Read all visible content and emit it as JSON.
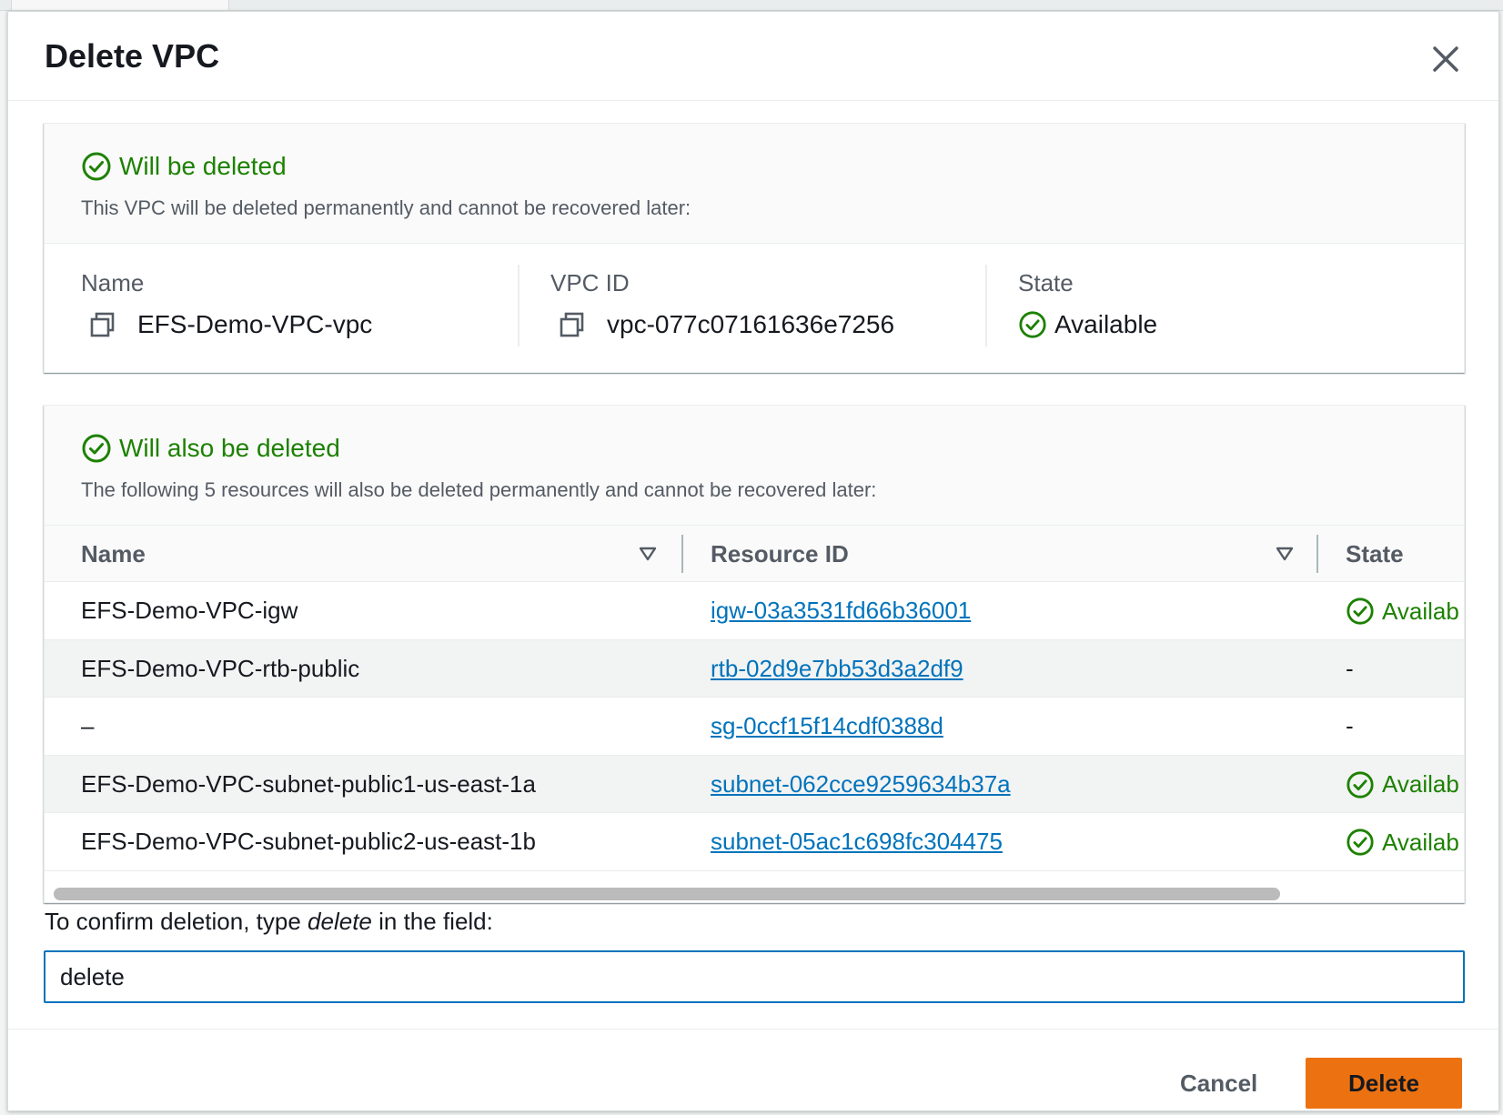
{
  "modal": {
    "title": "Delete VPC"
  },
  "primary": {
    "heading": "Will be deleted",
    "description": "This VPC will be deleted permanently and cannot be recovered later:",
    "name_label": "Name",
    "name_value": "EFS-Demo-VPC-vpc",
    "vpc_id_label": "VPC ID",
    "vpc_id_value": "vpc-077c07161636e7256",
    "state_label": "State",
    "state_value": "Available"
  },
  "secondary": {
    "heading": "Will also be deleted",
    "description": "The following 5 resources will also be deleted permanently and cannot be recovered later:",
    "columns": [
      "Name",
      "Resource ID",
      "State"
    ],
    "rows": [
      {
        "name": "EFS-Demo-VPC-igw",
        "resource_id": "igw-03a3531fd66b36001",
        "state": "Availab"
      },
      {
        "name": "EFS-Demo-VPC-rtb-public",
        "resource_id": "rtb-02d9e7bb53d3a2df9",
        "state": "-"
      },
      {
        "name": "–",
        "resource_id": "sg-0ccf15f14cdf0388d",
        "state": "-"
      },
      {
        "name": "EFS-Demo-VPC-subnet-public1-us-east-1a",
        "resource_id": "subnet-062cce9259634b37a",
        "state": "Availab"
      },
      {
        "name": "EFS-Demo-VPC-subnet-public2-us-east-1b",
        "resource_id": "subnet-05ac1c698fc304475",
        "state": "Availab"
      }
    ]
  },
  "confirm": {
    "label_prefix": "To confirm deletion, type ",
    "label_keyword": "delete",
    "label_suffix": " in the field:",
    "input_value": "delete"
  },
  "footer": {
    "cancel_label": "Cancel",
    "delete_label": "Delete"
  },
  "colors": {
    "success": "#1d8102",
    "link": "#0073bb",
    "primary_button": "#ec7211"
  },
  "icons": {
    "close": "close-icon",
    "success": "status-success-icon",
    "copy": "copy-icon",
    "sort": "sort-caret-icon"
  }
}
